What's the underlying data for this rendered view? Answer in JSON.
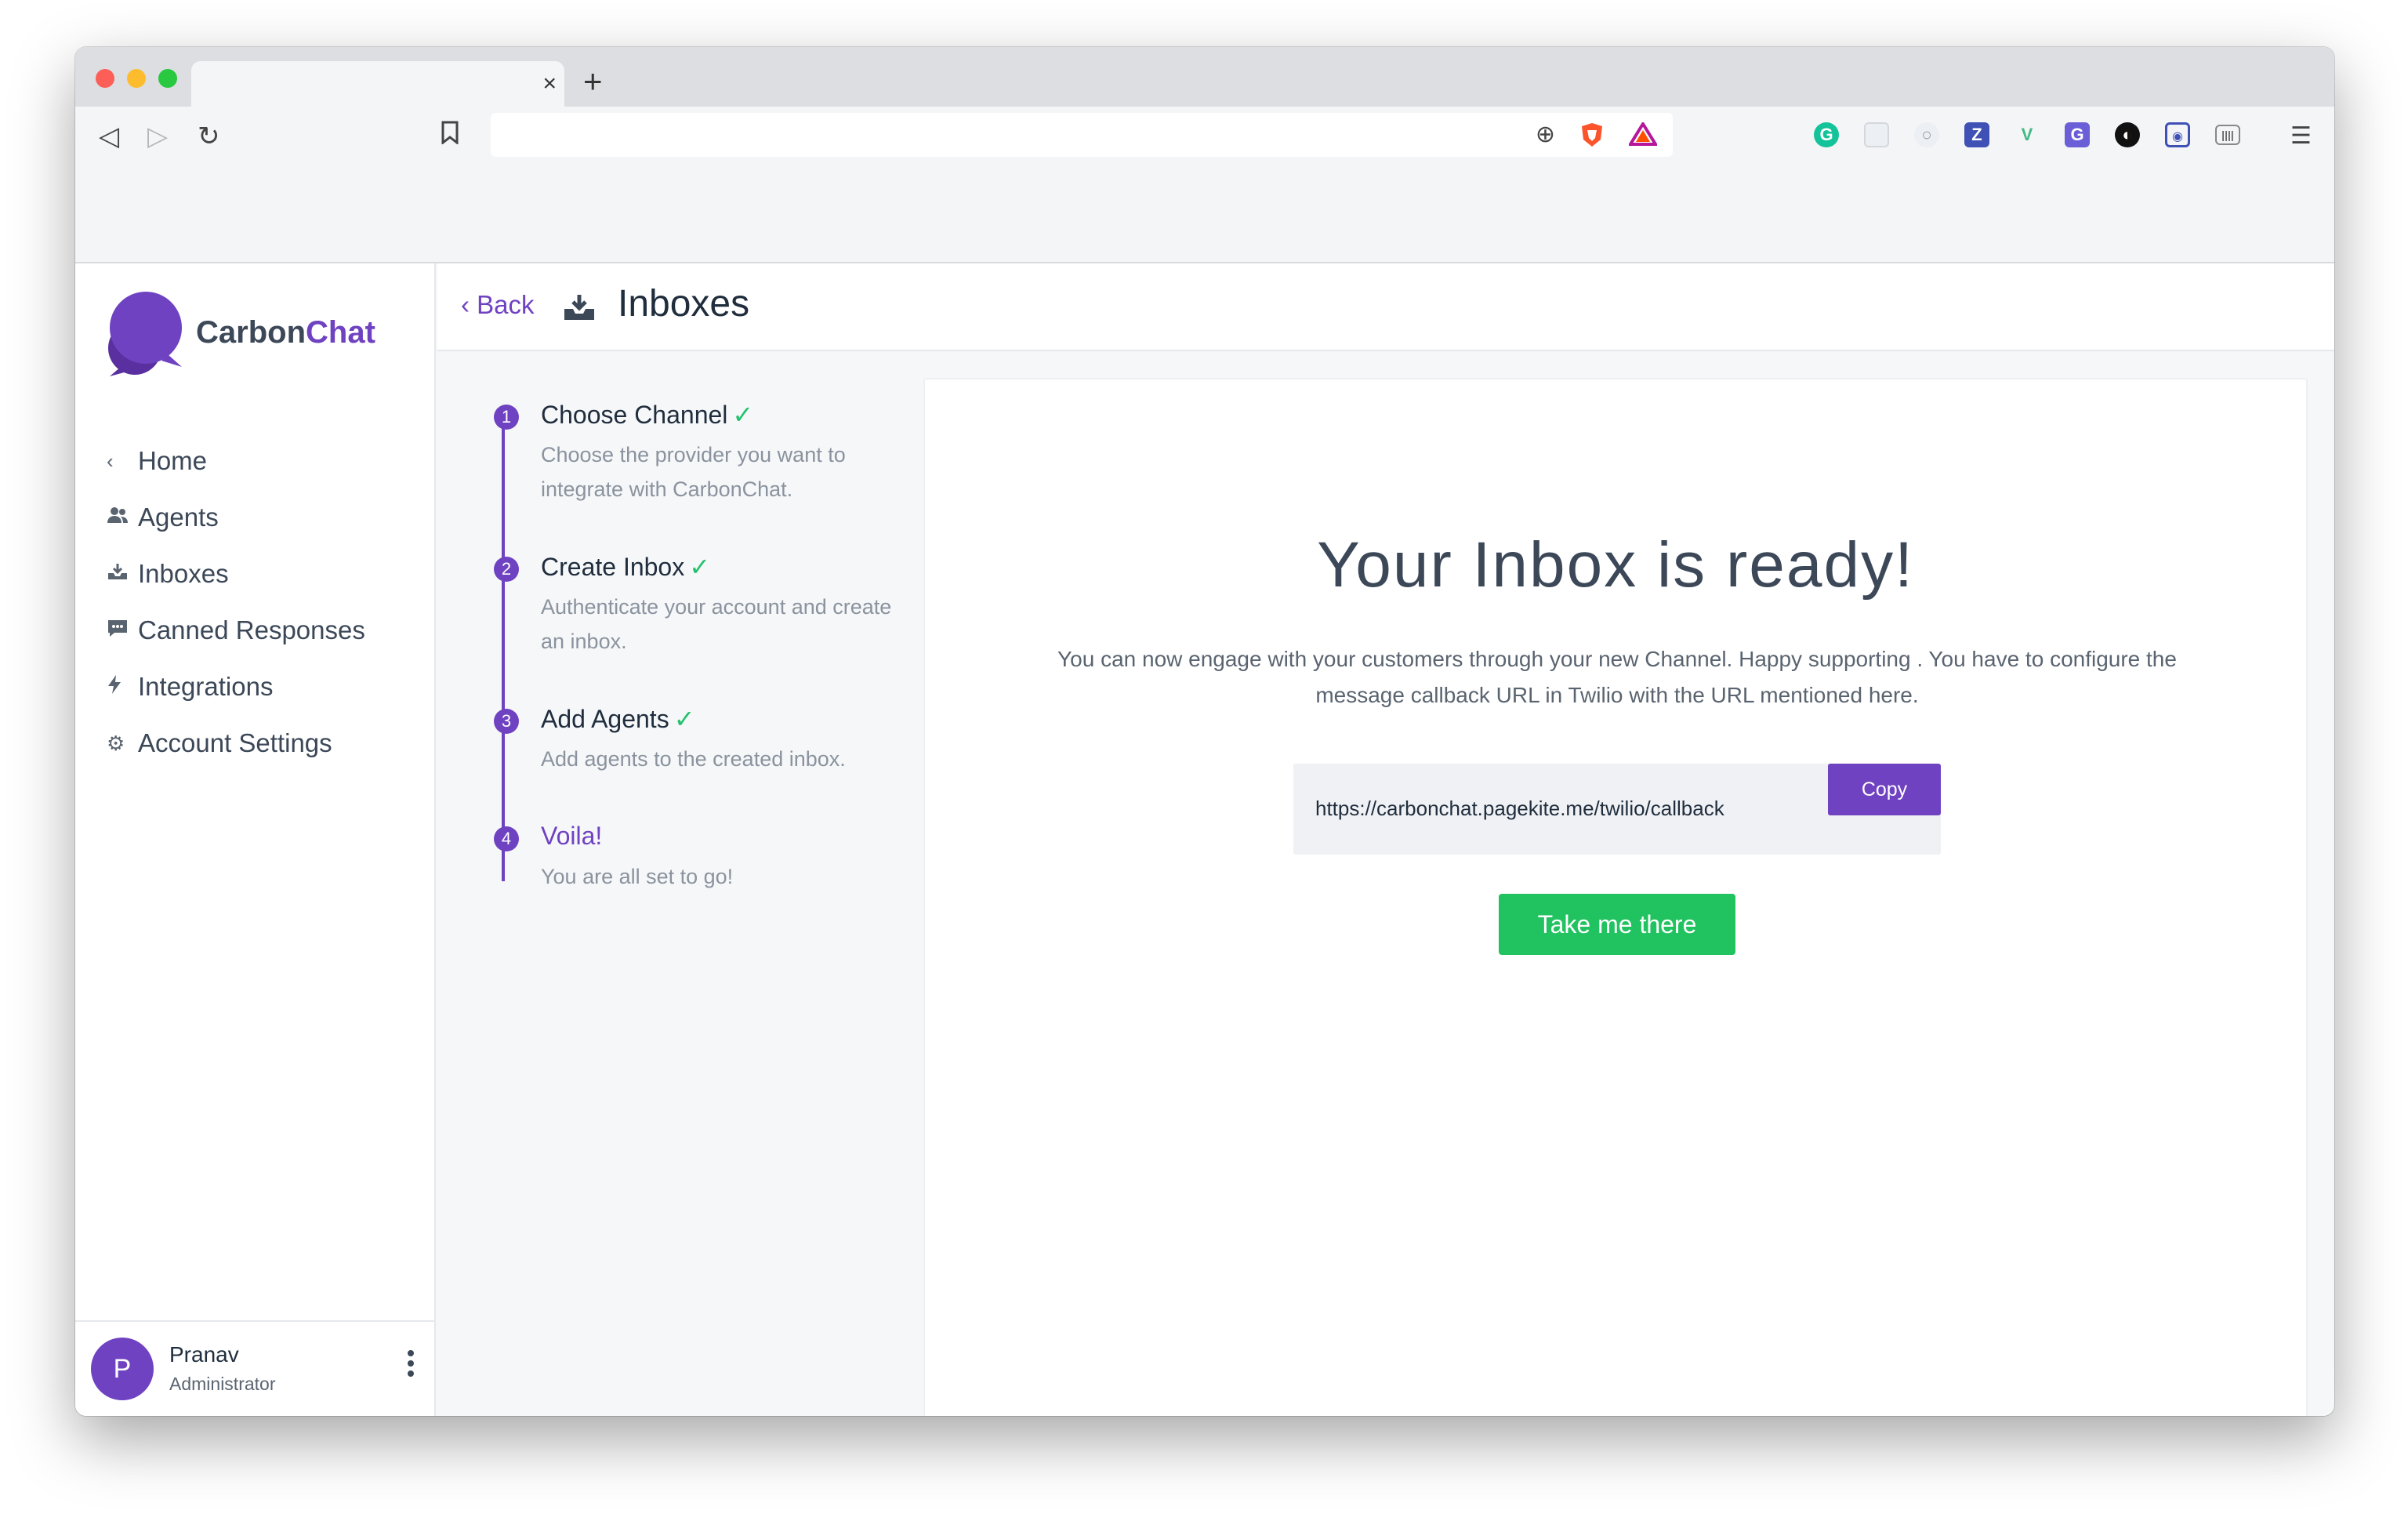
{
  "browser": {
    "tab_close": "×",
    "new_tab": "+",
    "back_icon": "◁",
    "forward_icon": "▷",
    "reload_icon": "↻",
    "bookmark_icon": "🔖",
    "address_url": "",
    "zoom_icon": "⊕",
    "menu_icon": "☰",
    "extensions": [
      "grammarly",
      "react-devtools",
      "eye-dropper",
      "z-extension",
      "vue-devtools",
      "translate",
      "dark-reader",
      "screenshot",
      "barcode"
    ]
  },
  "app": {
    "brand_main": "Carbon",
    "brand_accent": "Chat",
    "accent_color": "#6f42c1",
    "success_color": "#20c35f"
  },
  "sidebar": {
    "items": [
      {
        "label": "Home",
        "icon": "‹"
      },
      {
        "label": "Agents",
        "icon": "👥"
      },
      {
        "label": "Inboxes",
        "icon": "📥"
      },
      {
        "label": "Canned Responses",
        "icon": "💬"
      },
      {
        "label": "Integrations",
        "icon": "⚡"
      },
      {
        "label": "Account Settings",
        "icon": "⚙"
      }
    ]
  },
  "user": {
    "initial": "P",
    "name": "Pranav",
    "role": "Administrator"
  },
  "header": {
    "back_label": "Back",
    "title": "Inboxes"
  },
  "steps": [
    {
      "num": "1",
      "title": "Choose Channel",
      "check": "✓",
      "desc": "Choose the provider you want to integrate with CarbonChat."
    },
    {
      "num": "2",
      "title": "Create Inbox",
      "check": "✓",
      "desc": "Authenticate your account and create an inbox."
    },
    {
      "num": "3",
      "title": "Add Agents",
      "check": "✓",
      "desc": "Add agents to the created inbox."
    },
    {
      "num": "4",
      "title": "Voila!",
      "check": "",
      "desc": "You are all set to go!"
    }
  ],
  "card": {
    "title": "Your Inbox is ready!",
    "description": "You can now engage with your customers through your new Channel. Happy supporting . You have to configure the message callback URL in Twilio with the URL mentioned here.",
    "callback_url": "https://carbonchat.pagekite.me/twilio/callback",
    "copy_label": "Copy",
    "go_label": "Take me there"
  }
}
